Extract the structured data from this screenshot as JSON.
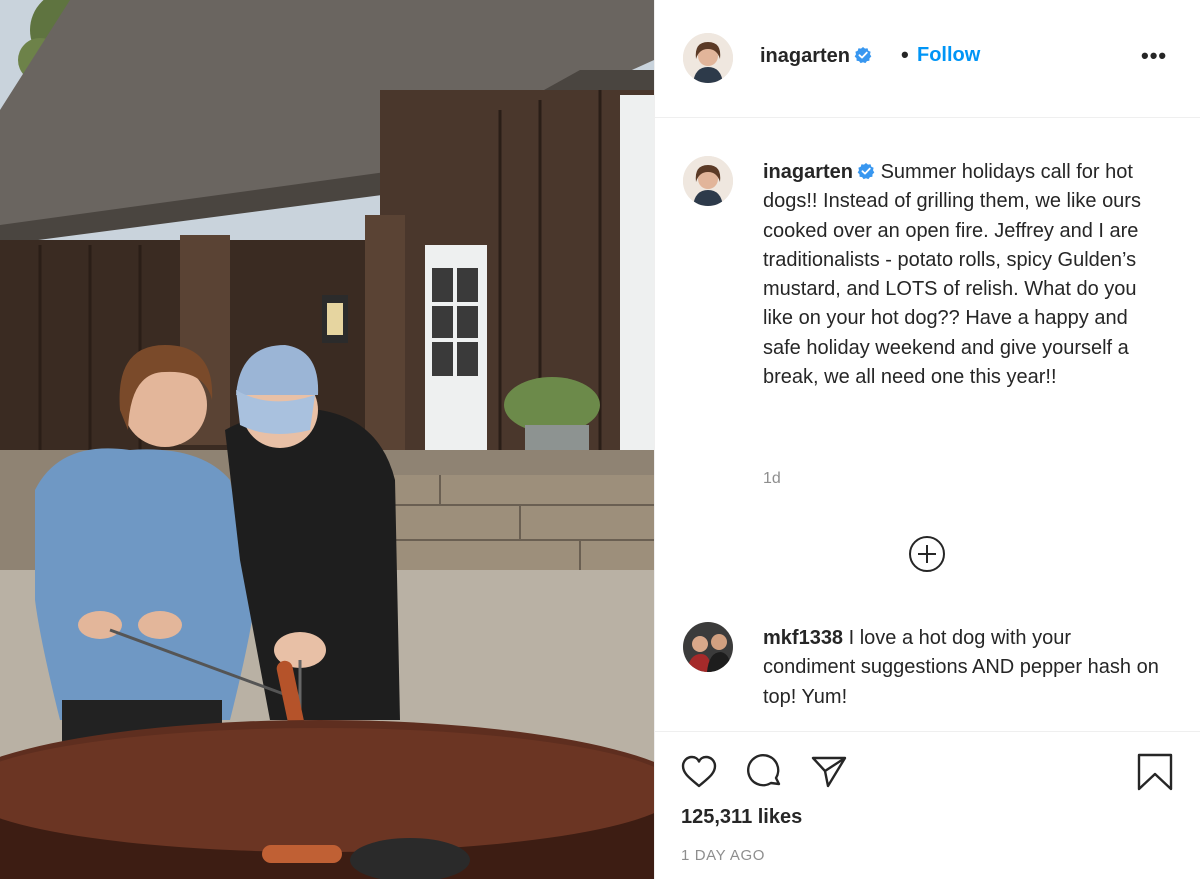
{
  "post": {
    "username": "inagarten",
    "follow_label": "Follow",
    "dot": "•",
    "more_label": "•••",
    "caption": "Summer holidays call for hot dogs!! Instead of grilling them, we like ours cooked over an open fire. Jeffrey and I are traditionalists - potato rolls, spicy Gulden’s mustard, and LOTS of relish. What do you like on your hot dog??  Have a happy and safe holiday weekend and give yourself a break, we all need one this year!!",
    "caption_time": "1d",
    "likes": "125,311 likes",
    "date": "1 DAY AGO"
  },
  "comments": [
    {
      "username": "mkf1338",
      "text": "I love a hot dog with your condiment suggestions AND pepper hash on top! Yum!"
    }
  ],
  "icons": {
    "verified": "verified-badge-icon",
    "like": "heart-icon",
    "comment": "comment-bubble-icon",
    "share": "paper-plane-icon",
    "save": "bookmark-icon",
    "load_more": "plus-circle-icon"
  },
  "colors": {
    "link": "#0095f6",
    "verified": "#3897f0",
    "muted": "#8e8e8e",
    "text": "#262626"
  }
}
